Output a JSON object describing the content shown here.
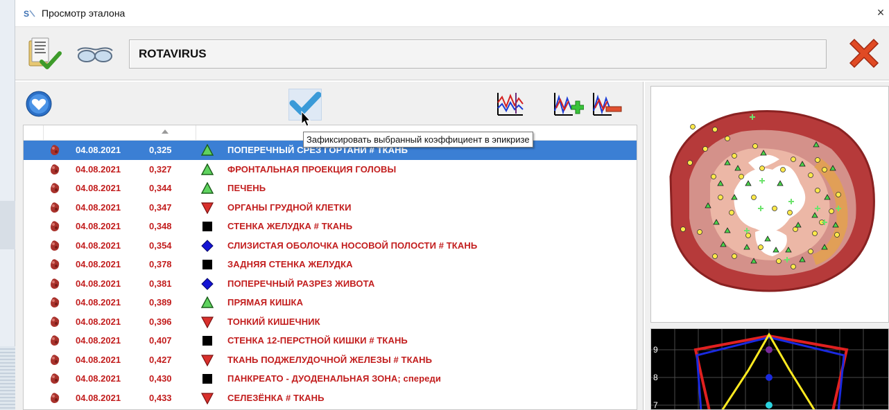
{
  "window": {
    "title": "Просмотр эталона",
    "close_glyph": "×"
  },
  "header": {
    "etalon_name": "ROTAVIRUS"
  },
  "tooltip": {
    "text": "Зафиксировать выбранный коэффициент в эпикризе"
  },
  "list": {
    "rows": [
      {
        "date": "04.08.2021",
        "coef": "0,325",
        "marker": "triangle-up-green",
        "name": "ПОПЕРЕЧНЫЙ  СРЕЗ  ГОРТАНИ # ТКАНЬ",
        "selected": true
      },
      {
        "date": "04.08.2021",
        "coef": "0,327",
        "marker": "triangle-up-green",
        "name": "ФРОНТАЛЬНАЯ  ПРОЕКЦИЯ  ГОЛОВЫ",
        "selected": false
      },
      {
        "date": "04.08.2021",
        "coef": "0,344",
        "marker": "triangle-up-green",
        "name": "ПЕЧЕНЬ",
        "selected": false
      },
      {
        "date": "04.08.2021",
        "coef": "0,347",
        "marker": "triangle-down-red",
        "name": "ОРГАНЫ  ГРУДНОЙ  КЛЕТКИ",
        "selected": false
      },
      {
        "date": "04.08.2021",
        "coef": "0,348",
        "marker": "square-black",
        "name": "СТЕНКА  ЖЕЛУДКА # ТКАНЬ",
        "selected": false
      },
      {
        "date": "04.08.2021",
        "coef": "0,354",
        "marker": "diamond-blue",
        "name": "СЛИЗИСТАЯ  ОБОЛОЧКА  НОСОВОЙ  ПОЛОСТИ # ТКАНЬ",
        "selected": false
      },
      {
        "date": "04.08.2021",
        "coef": "0,378",
        "marker": "square-black",
        "name": "ЗАДНЯЯ  СТЕНКА ЖЕЛУДКА",
        "selected": false
      },
      {
        "date": "04.08.2021",
        "coef": "0,381",
        "marker": "diamond-blue",
        "name": "ПОПЕРЕЧНЫЙ  РАЗРЕЗ ЖИВОТА",
        "selected": false
      },
      {
        "date": "04.08.2021",
        "coef": "0,389",
        "marker": "triangle-up-green",
        "name": "ПРЯМАЯ  КИШКА",
        "selected": false
      },
      {
        "date": "04.08.2021",
        "coef": "0,396",
        "marker": "triangle-down-red",
        "name": "ТОНКИЙ  КИШЕЧНИК",
        "selected": false
      },
      {
        "date": "04.08.2021",
        "coef": "0,407",
        "marker": "square-black",
        "name": "СТЕНКА  12-ПЕРСТНОЙ  КИШКИ # ТКАНЬ",
        "selected": false
      },
      {
        "date": "04.08.2021",
        "coef": "0,427",
        "marker": "triangle-down-red",
        "name": "ТКАНЬ  ПОДЖЕЛУДОЧНОЙ  ЖЕЛЕЗЫ # ТКАНЬ",
        "selected": false
      },
      {
        "date": "04.08.2021",
        "coef": "0,430",
        "marker": "square-black",
        "name": "ПАНКРЕАТО - ДУОДЕНАЛЬНАЯ  ЗОНА;  спереди",
        "selected": false
      },
      {
        "date": "04.08.2021",
        "coef": "0,433",
        "marker": "triangle-down-red",
        "name": "СЕЛЕЗЁНКА # ТКАНЬ",
        "selected": false
      }
    ]
  },
  "graph": {
    "y_labels": [
      "9",
      "8",
      "7"
    ]
  },
  "colors": {
    "selection": "#3b7fd4",
    "row_text": "#c21d1d",
    "marker_green": "#5fd35f",
    "marker_red": "#d9302c",
    "marker_blue": "#1414d4"
  }
}
